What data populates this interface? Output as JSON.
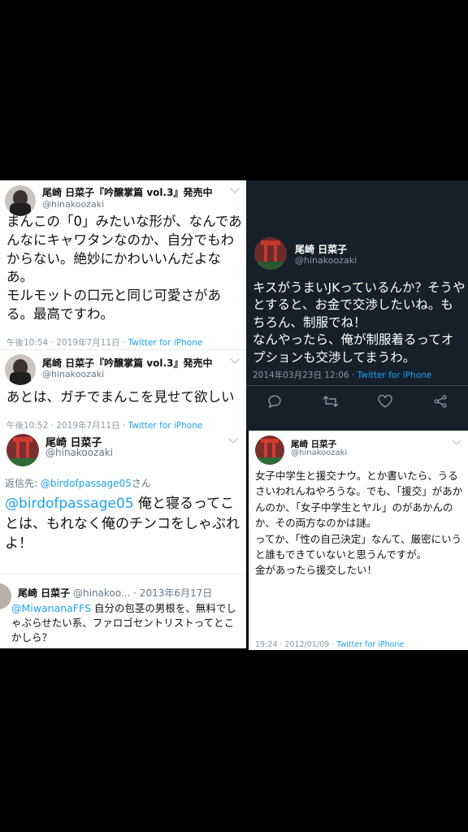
{
  "tweet1": {
    "name": "尾崎 日菜子『吟醸掌篇 vol.3』発売中",
    "handle": "@hinakoozaki",
    "body": "まんこの「0」みたいな形が、なんであんなにキャワタンなのか、自分でもわからない。絶妙にかわいいんだよなあ。\nモルモットの口元と同じ可愛さがある。最高ですわ。",
    "time": "午後10:54 · 2019年7月11日 · ",
    "source": "Twitter for iPhone"
  },
  "tweet2": {
    "name": "尾崎 日菜子『吟醸掌篇 vol.3』発売中",
    "handle": "@hinakoozaki",
    "body": "あとは、ガチでまんこを見せて欲しい",
    "time": "午後10:52 · 2019年7月11日 · ",
    "source": "Twitter for iPhone"
  },
  "tweet_dark": {
    "name": "尾崎 日菜子",
    "handle": "@hinakoozaki",
    "body": "キスがうまいJKっているんか？そうやとすると、お金で交渉したいね。もちろん、制服でね！\nなんやったら、俺が制服着るってオプションも交渉してまうわ。",
    "time": "2014年03月23日 12:06 · ",
    "source": "Twitter for iPhone",
    "icons": [
      "reply-icon",
      "retweet-icon",
      "like-icon",
      "share-icon"
    ]
  },
  "tweet_reply": {
    "name": "尾崎 日菜子",
    "handle": "@hinakoozaki",
    "reply_prefix": "返信先: ",
    "reply_to": "@birdofpassage05",
    "reply_suffix": "さん",
    "mention": "@birdofpassage05",
    "body": " 俺と寝るってことは、もれなく俺のチンコをしゃぶれよ！"
  },
  "tweet_old": {
    "name": "尾崎 日菜子",
    "handle": "@hinakoo...",
    "date": " · 2013年6月17日",
    "mention": "@MiwananaFFS",
    "body": " 自分の包茎の男根を、無料でしゃぶらせたい系、ファロゴセントリストってとこかしら？"
  },
  "tweet_right": {
    "name": "尾崎 日菜子",
    "handle": "@hinakoozaki",
    "body": "女子中学生と援交ナウ。とか書いたら、うるさいわれんねやろうな。でも、「援交」があかんのか、「女子中学生とヤル」のがあかんのか、その両方なのかは謎。\nってか、「性の自己決定」なんて、厳密にいうと誰もできていないと思うんですが。\n金があったら援交したい！",
    "time": "19:24 · 2012/01/09 · ",
    "source": "Twitter for iPhone"
  },
  "colors": {
    "accent": "#1da1f2",
    "dark_bg": "#15202b",
    "muted": "#657786"
  }
}
